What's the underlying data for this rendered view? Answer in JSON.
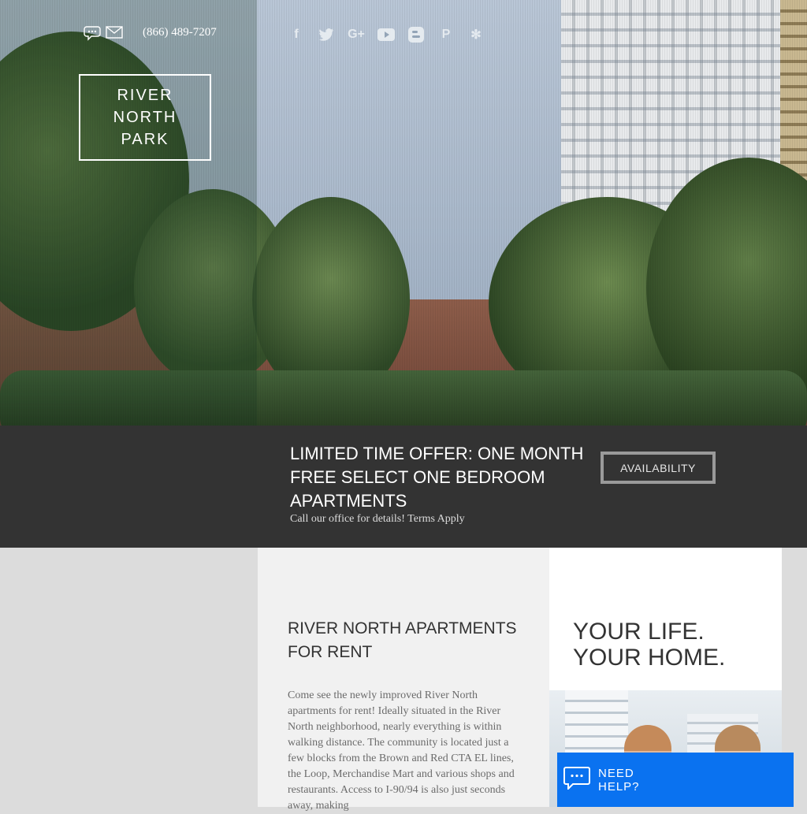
{
  "header": {
    "phone": "(866) 489-7207",
    "contact_icons": [
      "chat-icon",
      "mail-icon"
    ],
    "social_icons": [
      "facebook-icon",
      "twitter-icon",
      "google-plus-icon",
      "youtube-icon",
      "blogger-icon",
      "pinterest-icon",
      "yelp-icon"
    ],
    "logo_lines": [
      "RIVER",
      "NORTH",
      "PARK"
    ]
  },
  "offer": {
    "title": "LIMITED TIME OFFER: ONE MONTH FREE SELECT ONE BEDROOM APARTMENTS",
    "subtitle": "Call our office for details! Terms Apply",
    "button_label": "AVAILABILITY"
  },
  "main": {
    "heading": "RIVER NORTH APARTMENTS FOR RENT",
    "body": "Come see the newly improved River North apartments for rent! Ideally situated in the River North neighborhood, nearly everything is within walking distance. The community is located just a few blocks from the Brown and Red CTA EL lines, the Loop, Merchandise Mart and various shops and restaurants. Access to I-90/94 is also just seconds away, making"
  },
  "side": {
    "heading": "YOUR LIFE. YOUR HOME."
  },
  "help_widget": {
    "label": "NEED HELP?"
  },
  "colors": {
    "offer_bar": "#333333",
    "help_blue": "#0a72f0"
  }
}
